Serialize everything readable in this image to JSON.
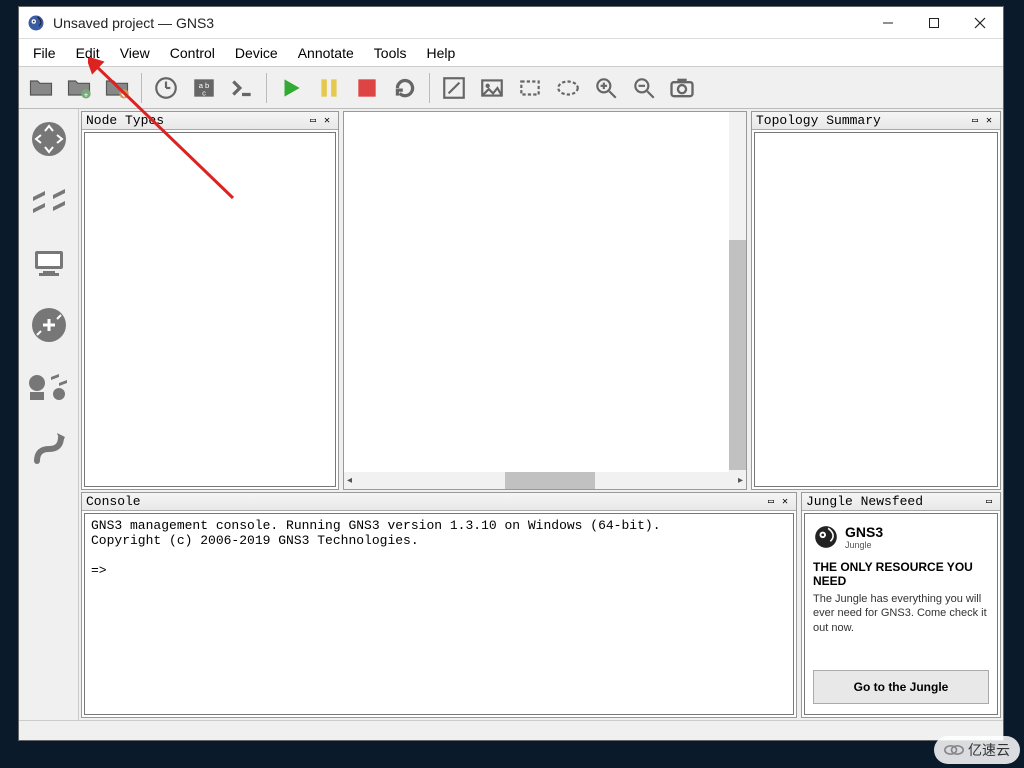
{
  "window": {
    "title": "Unsaved project — GNS3"
  },
  "menu": {
    "file": "File",
    "edit": "Edit",
    "view": "View",
    "control": "Control",
    "device": "Device",
    "annotate": "Annotate",
    "tools": "Tools",
    "help": "Help"
  },
  "panels": {
    "node_types": {
      "title": "Node Types"
    },
    "topology": {
      "title": "Topology Summary"
    },
    "console": {
      "title": "Console"
    },
    "newsfeed": {
      "title": "Jungle Newsfeed"
    }
  },
  "console": {
    "line1": "GNS3 management console. Running GNS3 version 1.3.10 on Windows (64-bit).",
    "line2": "Copyright (c) 2006-2019 GNS3 Technologies.",
    "prompt": "=>"
  },
  "news": {
    "brand": "GNS3",
    "brandsub": "Jungle",
    "headline": "THE ONLY RESOURCE YOU NEED",
    "text": "The Jungle has everything you will ever need for GNS3. Come check it out now.",
    "button": "Go to the Jungle"
  },
  "watermark": "亿速云"
}
